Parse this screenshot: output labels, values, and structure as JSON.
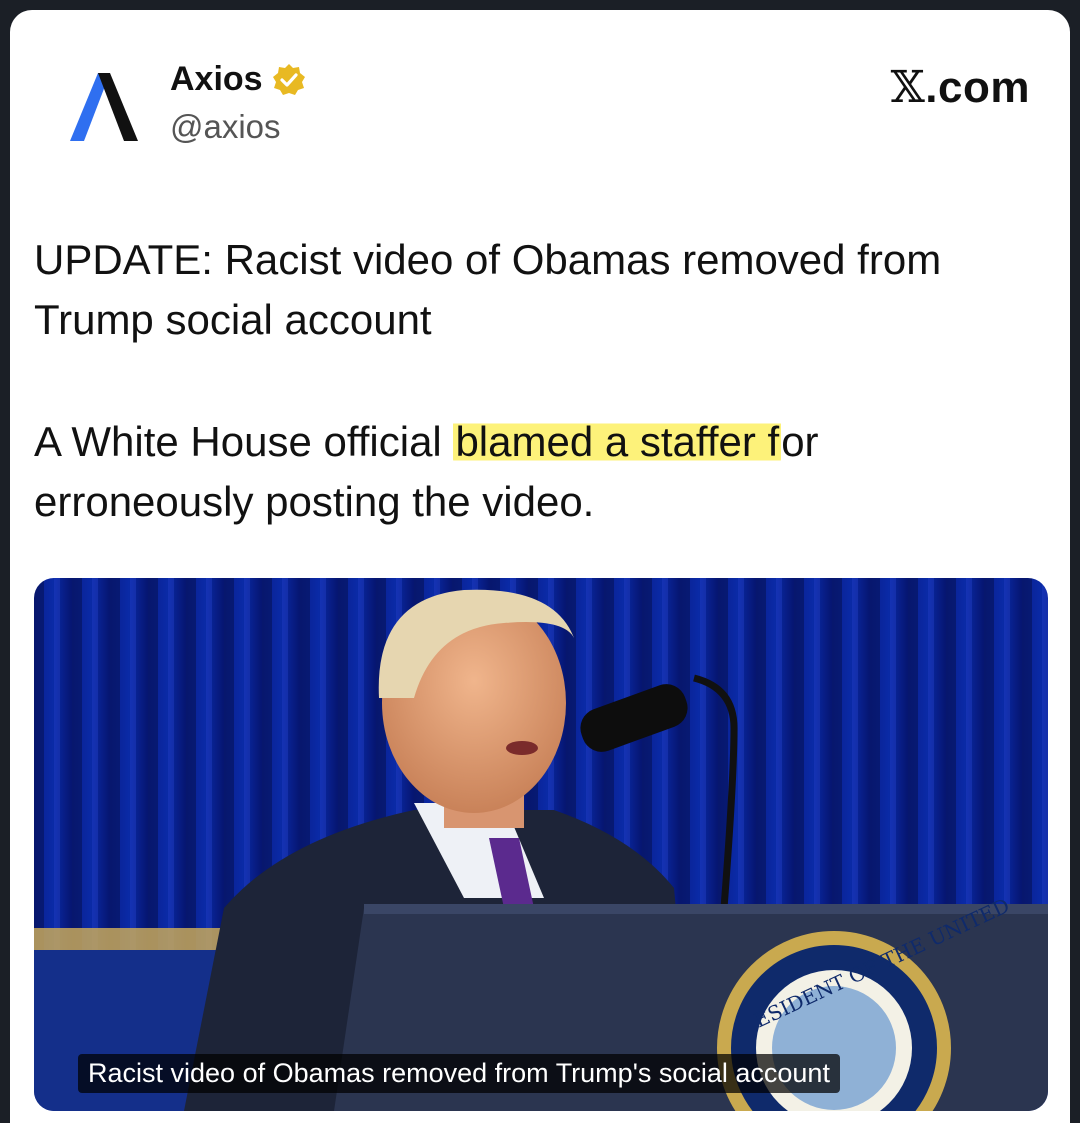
{
  "account": {
    "name": "Axios",
    "handle": "@axios",
    "verified_icon": "verified-badge-icon",
    "avatar_icon": "axios-logo-icon"
  },
  "site": {
    "x_glyph": "𝕏",
    "suffix": ".com"
  },
  "post": {
    "headline": "UPDATE: Racist video of Obamas removed from Trump social account",
    "body_before": "A White House official ",
    "body_highlight": "blamed a staffer f",
    "body_after": "or erroneously posting the video."
  },
  "media": {
    "caption": "Racist video of Obamas removed from Trump's social account",
    "seal_text": "ESIDENT OF THE UNITED"
  },
  "colors": {
    "highlight": "#fdf27a",
    "verified": "#e8b923",
    "axios_blue": "#2f6ff0"
  }
}
